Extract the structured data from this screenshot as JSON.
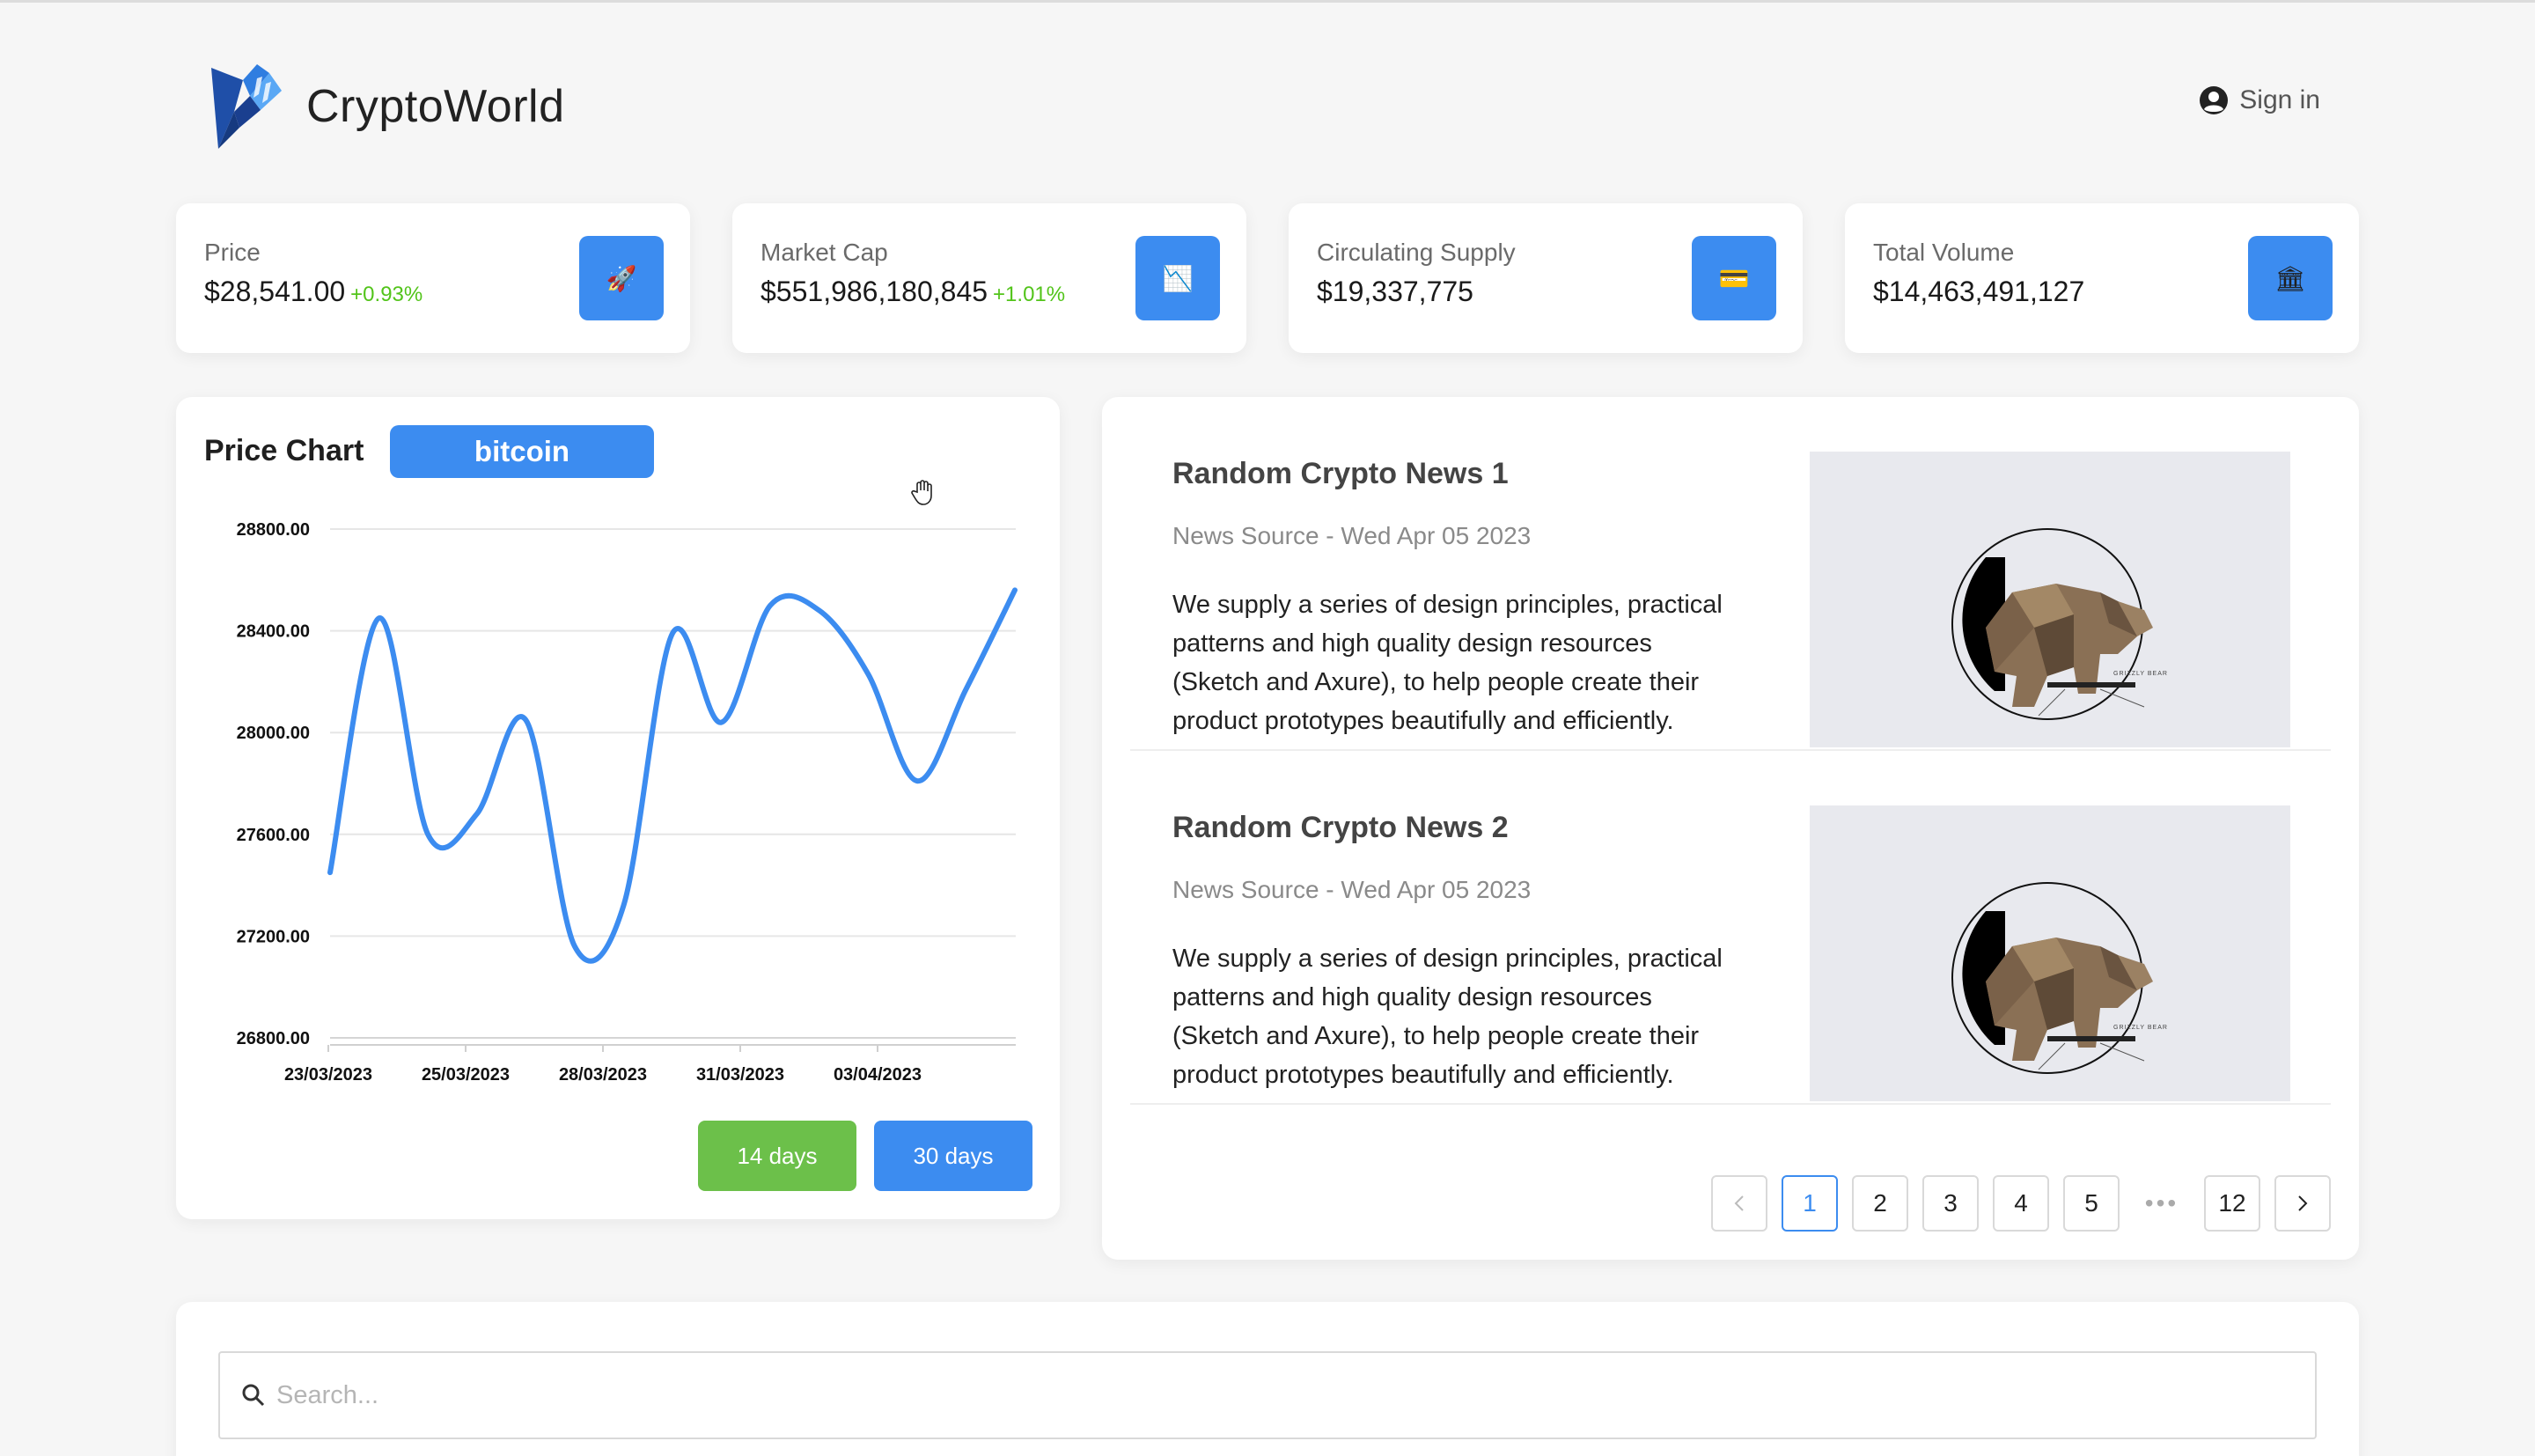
{
  "header": {
    "app_name": "CryptoWorld",
    "signin_label": "Sign in"
  },
  "stats": [
    {
      "label": "Price",
      "value": "$28,541.00",
      "change": "+0.93%",
      "icon": "rocket-icon",
      "glyph": "🚀"
    },
    {
      "label": "Market Cap",
      "value": "$551,986,180,845",
      "change": "+1.01%",
      "icon": "chart-icon",
      "glyph": "📉"
    },
    {
      "label": "Circulating Supply",
      "value": "$19,337,775",
      "change": "",
      "icon": "credit-card-icon",
      "glyph": "💳"
    },
    {
      "label": "Total Volume",
      "value": "$14,463,491,127",
      "change": "",
      "icon": "bank-icon",
      "glyph": "🏛"
    }
  ],
  "price_chart": {
    "title": "Price Chart",
    "coin": "bitcoin",
    "btn_14": "14 days",
    "btn_30": "30 days"
  },
  "chart_data": {
    "type": "line",
    "title": "Price Chart",
    "ylim": [
      26800,
      28800
    ],
    "yticks": [
      "28800.00",
      "28400.00",
      "28000.00",
      "27600.00",
      "27200.00",
      "26800.00"
    ],
    "xticks": [
      "23/03/2023",
      "25/03/2023",
      "28/03/2023",
      "31/03/2023",
      "03/04/2023"
    ],
    "grid": true,
    "legend": "none",
    "color": "#3c8cf0",
    "series": [
      {
        "values": [
          27450,
          28450,
          27600,
          27680,
          28050,
          27160,
          27320,
          28390,
          28040,
          28500,
          28480,
          28230,
          27810,
          28170,
          28560
        ]
      }
    ]
  },
  "news": [
    {
      "title": "Random Crypto News 1",
      "source": "News Source - Wed Apr 05 2023",
      "description": "We supply a series of design principles, practical patterns and high quality design resources (Sketch and Axure), to help people create their product prototypes beautifully and efficiently.",
      "image_caption": "GRIZZLY BEAR"
    },
    {
      "title": "Random Crypto News 2",
      "source": "News Source - Wed Apr 05 2023",
      "description": "We supply a series of design principles, practical patterns and high quality design resources (Sketch and Axure), to help people create their product prototypes beautifully and efficiently.",
      "image_caption": "GRIZZLY BEAR"
    }
  ],
  "pagination": {
    "pages": [
      "1",
      "2",
      "3",
      "4",
      "5"
    ],
    "ellipsis": "•••",
    "last": "12",
    "current": "1"
  },
  "search": {
    "placeholder": "Search..."
  }
}
